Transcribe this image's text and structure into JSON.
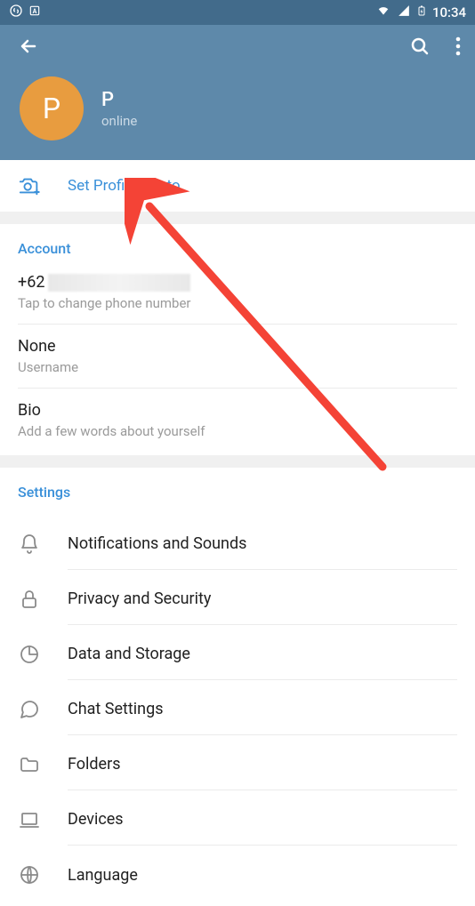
{
  "status": {
    "time": "10:34"
  },
  "header": {
    "avatar_letter": "P",
    "name": "P",
    "status": "online"
  },
  "set_photo": {
    "label": "Set Profile Photo"
  },
  "account": {
    "title": "Account",
    "phone_prefix": "+62",
    "phone_caption": "Tap to change phone number",
    "username_value": "None",
    "username_caption": "Username",
    "bio_value": "Bio",
    "bio_caption": "Add a few words about yourself"
  },
  "settings": {
    "title": "Settings",
    "items": [
      {
        "label": "Notifications and Sounds"
      },
      {
        "label": "Privacy and Security"
      },
      {
        "label": "Data and Storage"
      },
      {
        "label": "Chat Settings"
      },
      {
        "label": "Folders"
      },
      {
        "label": "Devices"
      },
      {
        "label": "Language"
      }
    ]
  }
}
